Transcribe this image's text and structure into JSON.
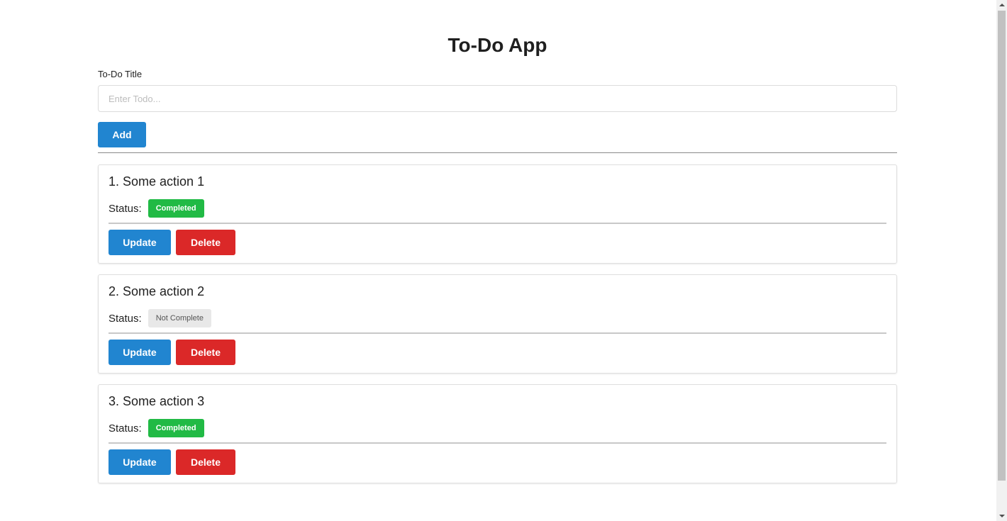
{
  "app": {
    "title": "To-Do App"
  },
  "form": {
    "label": "To-Do Title",
    "placeholder": "Enter Todo...",
    "value": "",
    "add_label": "Add"
  },
  "todos": [
    {
      "title": "1. Some action 1",
      "status_label": "Status:",
      "status": "Completed",
      "update_label": "Update",
      "delete_label": "Delete"
    },
    {
      "title": "2. Some action 2",
      "status_label": "Status:",
      "status": "Not Complete",
      "update_label": "Update",
      "delete_label": "Delete"
    },
    {
      "title": "3. Some action 3",
      "status_label": "Status:",
      "status": "Completed",
      "update_label": "Update",
      "delete_label": "Delete"
    }
  ],
  "colors": {
    "primary": "#2185d0",
    "danger": "#db2828",
    "success": "#21ba45",
    "neutral_badge": "#e8e8e8"
  }
}
